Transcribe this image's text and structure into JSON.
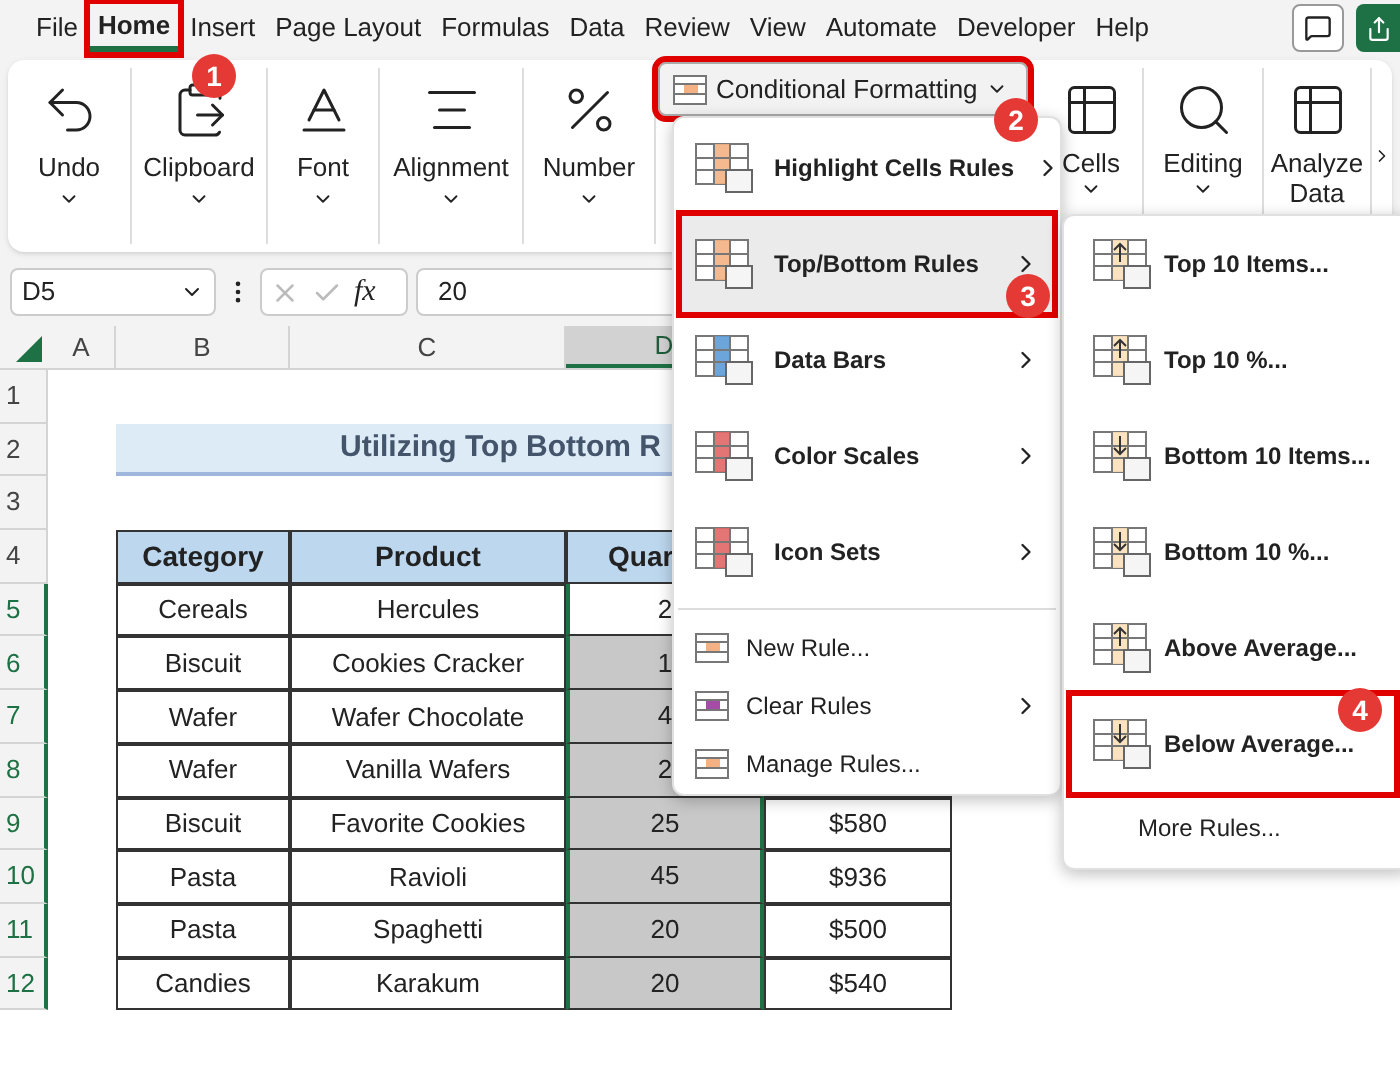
{
  "menu_tabs": [
    {
      "label": "File",
      "selected": false
    },
    {
      "label": "Home",
      "selected": true,
      "callout": "1"
    },
    {
      "label": "Insert",
      "selected": false
    },
    {
      "label": "Page Layout",
      "selected": false
    },
    {
      "label": "Formulas",
      "selected": false
    },
    {
      "label": "Data",
      "selected": false
    },
    {
      "label": "Review",
      "selected": false
    },
    {
      "label": "View",
      "selected": false
    },
    {
      "label": "Automate",
      "selected": false
    },
    {
      "label": "Developer",
      "selected": false
    },
    {
      "label": "Help",
      "selected": false
    }
  ],
  "ribbon": {
    "groups_left": [
      {
        "label": "Undo"
      },
      {
        "label": "Clipboard"
      },
      {
        "label": "Font"
      },
      {
        "label": "Alignment"
      },
      {
        "label": "Number"
      }
    ],
    "conditional_formatting": {
      "label": "Conditional Formatting",
      "callout": "2"
    },
    "groups_right": [
      {
        "label": "Cells"
      },
      {
        "label": "Editing"
      },
      {
        "label": "Analyze Data"
      }
    ]
  },
  "formula_bar": {
    "name_box": "D5",
    "fx": "fx",
    "value": "20"
  },
  "sheet": {
    "columns": [
      {
        "label": "A",
        "selected": false
      },
      {
        "label": "B",
        "selected": false
      },
      {
        "label": "C",
        "selected": false
      },
      {
        "label": "D",
        "selected": true
      }
    ],
    "row_headers": [
      {
        "label": "1",
        "selected": false
      },
      {
        "label": "2",
        "selected": false
      },
      {
        "label": "3",
        "selected": false
      },
      {
        "label": "4",
        "selected": false
      },
      {
        "label": "5",
        "selected": true
      },
      {
        "label": "6",
        "selected": true
      },
      {
        "label": "7",
        "selected": true
      },
      {
        "label": "8",
        "selected": true
      },
      {
        "label": "9",
        "selected": true
      },
      {
        "label": "10",
        "selected": true
      },
      {
        "label": "11",
        "selected": true
      },
      {
        "label": "12",
        "selected": true
      }
    ],
    "title": "Utilizing Top Bottom R",
    "table_header": {
      "category": "Category",
      "product": "Product",
      "quantity": "Quar"
    },
    "rows": [
      {
        "category": "Cereals",
        "product": "Hercules",
        "quantity": "2",
        "active": true
      },
      {
        "category": "Biscuit",
        "product": "Cookies Cracker",
        "quantity": "1",
        "active": false
      },
      {
        "category": "Wafer",
        "product": "Wafer Chocolate",
        "quantity": "4",
        "active": false
      },
      {
        "category": "Wafer",
        "product": "Vanilla Wafers",
        "quantity": "2",
        "active": false
      },
      {
        "category": "Biscuit",
        "product": "Favorite Cookies",
        "quantity": "25",
        "column_4": "$580",
        "active": false
      },
      {
        "category": "Pasta",
        "product": "Ravioli",
        "quantity": "45",
        "column_4": "$936",
        "active": false
      },
      {
        "category": "Pasta",
        "product": "Spaghetti",
        "quantity": "20",
        "column_4": "$500",
        "active": false
      },
      {
        "category": "Candies",
        "product": "Karakum",
        "quantity": "20",
        "column_4": "$540",
        "active": false
      }
    ]
  },
  "menu": {
    "items": [
      {
        "kind": "large",
        "label": "Highlight Cells Rules",
        "submenu": true,
        "selected": false
      },
      {
        "kind": "large",
        "label": "Top/Bottom Rules",
        "submenu": true,
        "selected": true,
        "callout": "3"
      },
      {
        "kind": "large",
        "label": "Data Bars",
        "submenu": true,
        "selected": false
      },
      {
        "kind": "large",
        "label": "Color Scales",
        "submenu": true,
        "selected": false
      },
      {
        "kind": "large",
        "label": "Icon Sets",
        "submenu": true,
        "selected": false
      },
      {
        "kind": "small",
        "label": "New Rule...",
        "submenu": false,
        "selected": false
      },
      {
        "kind": "small",
        "label": "Clear Rules",
        "submenu": true,
        "selected": false
      },
      {
        "kind": "small",
        "label": "Manage Rules...",
        "submenu": false,
        "selected": false
      }
    ]
  },
  "submenu": {
    "items": [
      {
        "kind": "large",
        "label": "Top 10 Items..."
      },
      {
        "kind": "large",
        "label": "Top 10 %..."
      },
      {
        "kind": "large",
        "label": "Bottom 10 Items..."
      },
      {
        "kind": "large",
        "label": "Bottom 10 %..."
      },
      {
        "kind": "large",
        "label": "Above Average..."
      },
      {
        "kind": "large",
        "label": "Below Average...",
        "callout": "4"
      },
      {
        "kind": "plain",
        "label": "More Rules..."
      }
    ]
  }
}
